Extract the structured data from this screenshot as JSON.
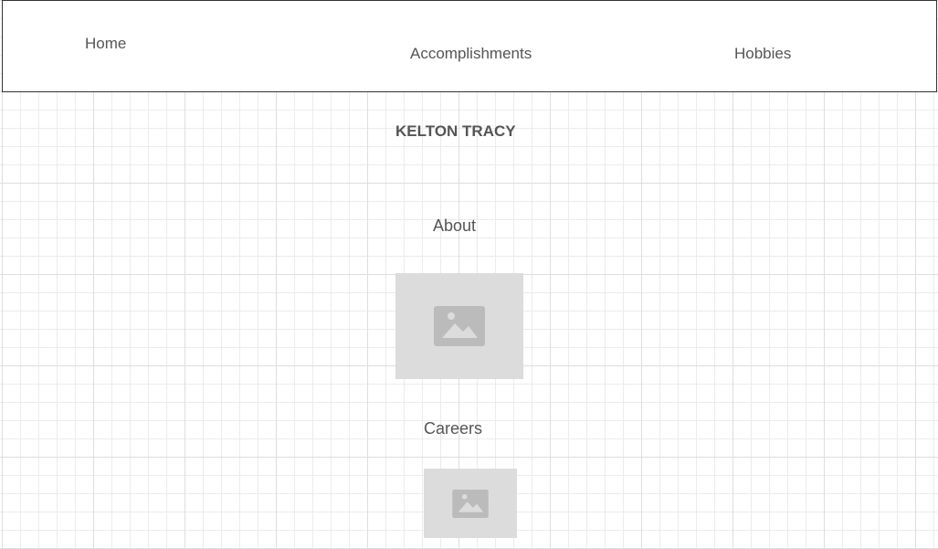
{
  "nav": {
    "home_label": "Home",
    "accomplishments_label": "Accomplishments",
    "hobbies_label": "Hobbies"
  },
  "page": {
    "title": "KELTON TRACY"
  },
  "sections": {
    "about_heading": "About",
    "careers_heading": "Careers"
  },
  "icons": {
    "about_image_icon": "image-icon",
    "careers_image_icon": "image-icon"
  },
  "colors": {
    "text": "#555555",
    "placeholder_background": "#dcdcdc",
    "placeholder_icon": "#bbbbbb"
  }
}
